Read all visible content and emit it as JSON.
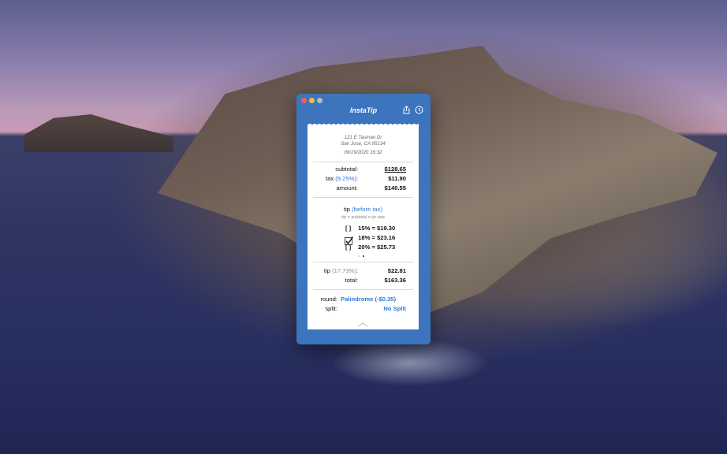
{
  "app": {
    "title": "InstaTip"
  },
  "receipt": {
    "address_line1": "121 E Tasman Dr",
    "address_line2": "San Jose, CA 95134",
    "datetime": "06/29/2020 16:32",
    "subtotal_label": "subtotal:",
    "subtotal_value": "$128.65",
    "tax_label": "tax",
    "tax_rate": "(9.25%)",
    "tax_colon": ":",
    "tax_value": "$11.90",
    "amount_label": "amount:",
    "amount_value": "$140.55",
    "tip_header_prefix": "tip",
    "tip_header_basis": "(before tax)",
    "tip_formula": "tip = subtotal x tip rate",
    "tip_options": [
      {
        "box": "[ ]",
        "percent": "15%",
        "equals": "=",
        "amount": "$19.30",
        "checked": false
      },
      {
        "box": "",
        "percent": "18%",
        "equals": "=",
        "amount": "$23.16",
        "checked": true
      },
      {
        "box": "[ ]",
        "percent": "20%",
        "equals": "=",
        "amount": "$25.73",
        "checked": false
      }
    ],
    "page_dots": {
      "count": 2,
      "active_index": 1
    },
    "tip_label": "tip",
    "tip_rate": "(17.73%)",
    "tip_colon": ":",
    "tip_value": "$22.81",
    "total_label": "total:",
    "total_value": "$163.36",
    "round_label": "round:",
    "round_value": "Palindrome (-$0.35)",
    "split_label": "split:",
    "split_value": "No Split"
  },
  "icons": {
    "share": "share-icon",
    "history": "history-icon",
    "check": "checkmark-icon",
    "expand": "chevron-up-icon"
  },
  "colors": {
    "window_blue": "#3c74be",
    "accent_blue": "#2e7ad6"
  }
}
